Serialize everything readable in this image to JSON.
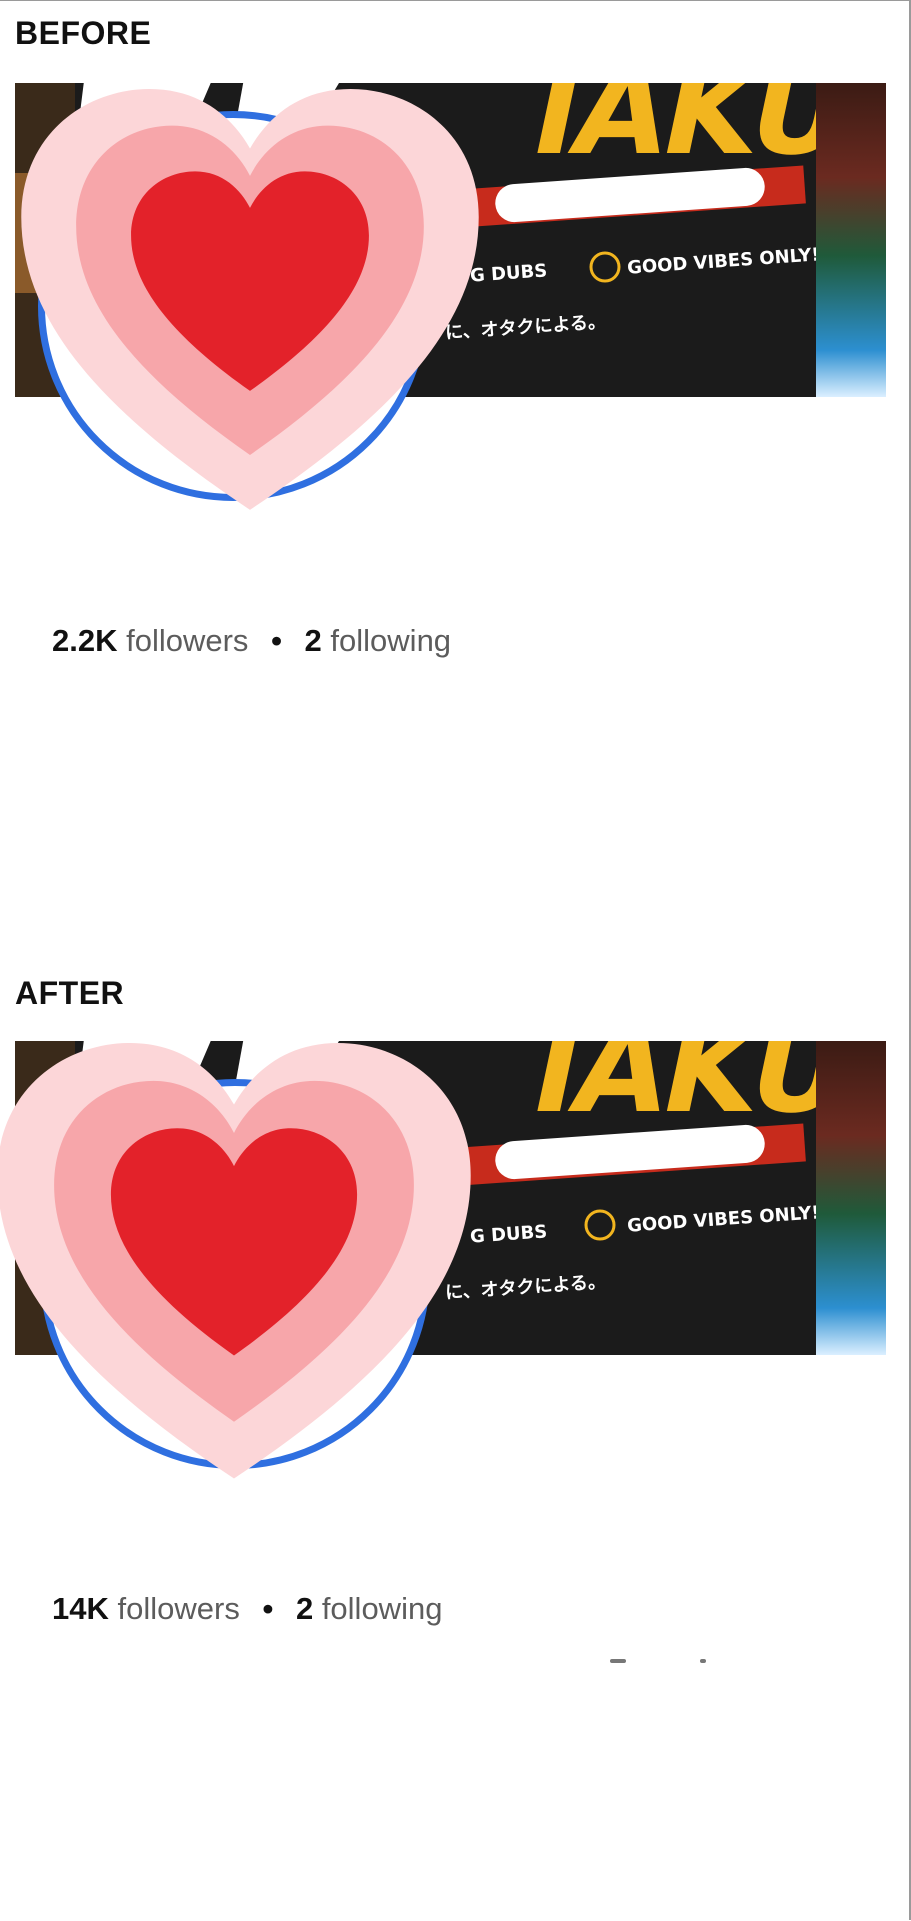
{
  "before": {
    "title": "BEFORE",
    "banner": {
      "title_fragment": "IAKU",
      "tag_left": "G DUBS",
      "tag_right": "GOOD VIBES ONLY!",
      "japanese": "に、オタクによる。"
    },
    "stats": {
      "followers_count": "2.2K",
      "followers_label": "followers",
      "separator": "•",
      "following_count": "2",
      "following_label": "following"
    }
  },
  "after": {
    "title": "AFTER",
    "banner": {
      "title_fragment": "IAKU",
      "tag_left": "G DUBS",
      "tag_right": "GOOD VIBES ONLY!",
      "japanese": "に、オタクによる。"
    },
    "stats": {
      "followers_count": "14K",
      "followers_label": "followers",
      "separator": "•",
      "following_count": "2",
      "following_label": "following"
    }
  },
  "colors": {
    "ring": "#2f6fe0",
    "heart_outer": "#fcd6d8",
    "heart_mid": "#f7a6aa",
    "heart_inner": "#e3222a",
    "banner_accent": "#f2b51f",
    "banner_bg": "#1b1b1b"
  },
  "icons": {
    "avatar_sticker": "growing-heart-icon",
    "smiley": "smiley-icon"
  }
}
